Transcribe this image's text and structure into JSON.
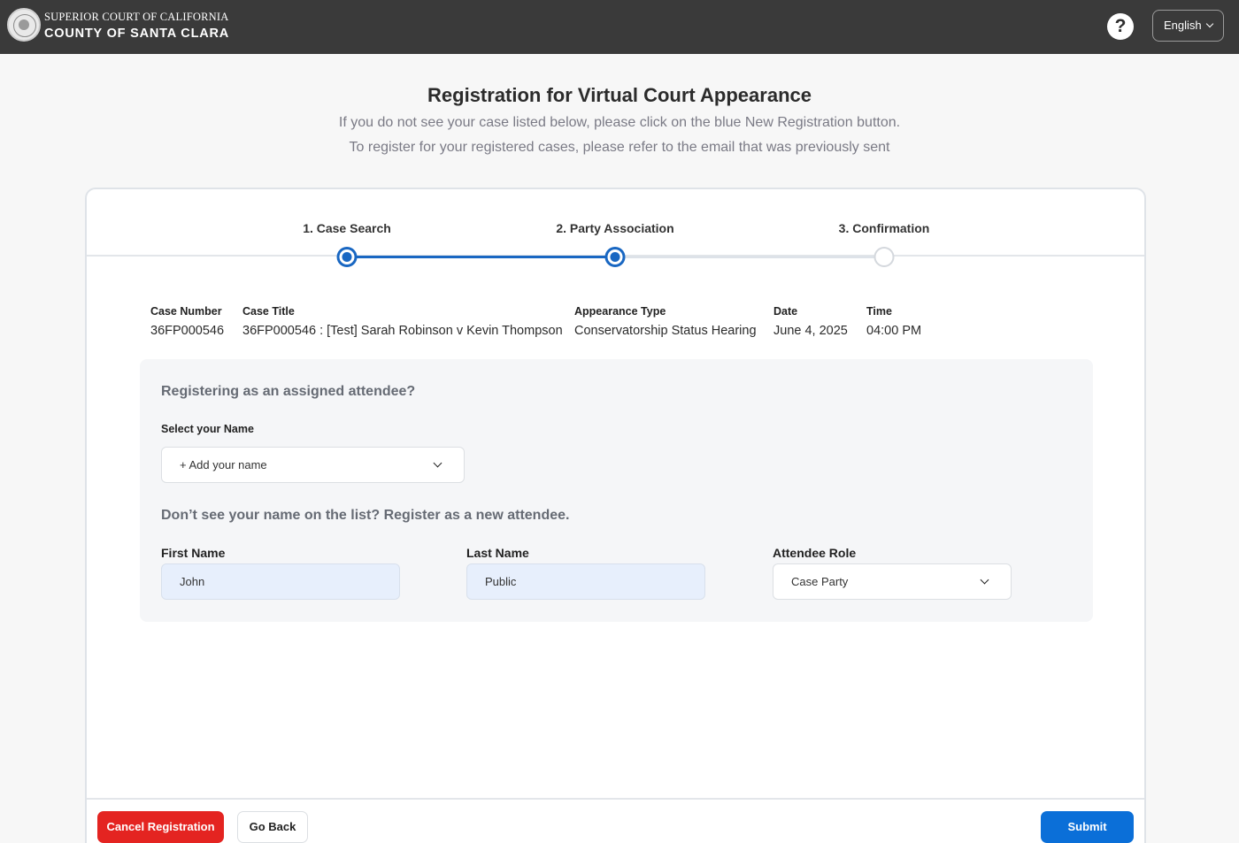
{
  "header": {
    "court_line1": "SUPERIOR COURT OF CALIFORNIA",
    "court_line2": "COUNTY OF SANTA CLARA",
    "help_label": "?",
    "language": "English"
  },
  "page": {
    "title": "Registration for Virtual Court Appearance",
    "subtitle_1": "If you do not see your case listed below, please click on the blue New Registration button.",
    "subtitle_2": "To register for your registered cases, please refer to the email that was previously sent"
  },
  "steps": [
    {
      "label": "1. Case Search",
      "state": "completed"
    },
    {
      "label": "2. Party Association",
      "state": "current"
    },
    {
      "label": "3. Confirmation",
      "state": "pending"
    }
  ],
  "case": {
    "headers": {
      "number": "Case Number",
      "title": "Case Title",
      "appearance_type": "Appearance Type",
      "date": "Date",
      "time": "Time"
    },
    "values": {
      "number": "36FP000546",
      "title": "36FP000546 : [Test] Sarah Robinson v Kevin Thompson",
      "appearance_type": "Conservatorship Status Hearing",
      "date": "June 4, 2025",
      "time": "04:00 PM"
    }
  },
  "registration": {
    "assigned_heading": "Registering as an assigned attendee?",
    "select_name_label": "Select your Name",
    "select_name_value": "+ Add your name",
    "new_attendee_heading": "Don’t see your name on the list? Register as a new attendee.",
    "first_name_label": "First Name",
    "first_name_value": "John",
    "last_name_label": "Last Name",
    "last_name_value": "Public",
    "role_label": "Attendee Role",
    "role_value": "Case Party"
  },
  "footer": {
    "cancel_label": "Cancel Registration",
    "back_label": "Go Back",
    "submit_label": "Submit"
  },
  "colors": {
    "header_bg": "#3a3a3a",
    "accent_blue": "#1967c2",
    "submit_blue": "#0b6fd8",
    "cancel_red": "#e42421",
    "input_fill": "#e7effc"
  }
}
